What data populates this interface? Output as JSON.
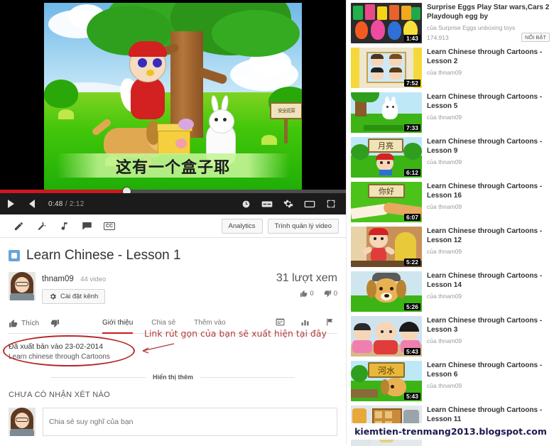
{
  "player": {
    "current_time": "0:48",
    "total_time": "2:12",
    "subtitle": "这有一个盒子耶",
    "sign_text": "安全花草",
    "progress_percent": 37,
    "accent_color": "#cc181e",
    "controls": {
      "play": "play-button",
      "volume": "volume-button",
      "watch_later": "watch-later-icon",
      "captions": "captions-icon",
      "settings": "settings-gear-icon",
      "theater": "theater-mode-icon",
      "fullscreen": "fullscreen-icon"
    }
  },
  "edit_toolbar": {
    "icons": [
      "pencil-icon",
      "magic-wand-icon",
      "music-note-icon",
      "annotation-bubble-icon",
      "cc-icon"
    ],
    "cc_label": "CC",
    "analytics_label": "Analytics",
    "video_manager_label": "Trình quản lý video"
  },
  "video": {
    "title": "Learn Chinese - Lesson 1",
    "channel_name": "thnam09",
    "channel_video_count": "44 video",
    "channel_settings_label": "Cài đặt kênh",
    "views": "31 lượt xem",
    "likes": "0",
    "dislikes": "0"
  },
  "tabs": {
    "like_label": "Thích",
    "items": [
      {
        "label": "Giới thiệu",
        "active": true
      },
      {
        "label": "Chia sẻ",
        "active": false
      },
      {
        "label": "Thêm vào",
        "active": false
      }
    ],
    "icons": [
      "subtitles-icon",
      "statistics-icon",
      "report-flag-icon"
    ]
  },
  "description": {
    "published": "Đã xuất bản vào 23-02-2014",
    "text": "Learn chinese through Cartoons",
    "annotation": "Link rút gọn của bạn sẽ xuất hiện tại đây",
    "annotation_color": "#b23a3a"
  },
  "show_more": {
    "label": "Hiển thị thêm"
  },
  "comments": {
    "empty_label": "CHƯA CÓ NHẬN XÉT NÀO",
    "placeholder": "Chia sẻ suy nghĩ của bạn"
  },
  "sidebar": {
    "watermark": "kiemtien-trenmang2013.blogspot.com",
    "items": [
      {
        "title": "Surprise Eggs Play Star wars,Cars 2 Playdough egg by",
        "by": "của Surprise Eggs unboxing toys",
        "views": "174.913",
        "duration": "1:43",
        "badge": "NỔI BẬT",
        "thumb": "playdough-eggs"
      },
      {
        "title": "Learn Chinese through Cartoons - Lesson 2",
        "by": "của thnam09",
        "views": "",
        "duration": "7:52",
        "badge": "",
        "thumb": "classroom-kids"
      },
      {
        "title": "Learn Chinese through Cartoons - Lesson 5",
        "by": "của thnam09",
        "views": "",
        "duration": "7:33",
        "badge": "",
        "thumb": "rabbit-tree"
      },
      {
        "title": "Learn Chinese through Cartoons - Lesson 9",
        "by": "của thnam09",
        "views": "",
        "duration": "6:12",
        "badge": "",
        "thumb": "moon-sign"
      },
      {
        "title": "Learn Chinese through Cartoons - Lesson 16",
        "by": "của thnam09",
        "views": "",
        "duration": "6:07",
        "badge": "",
        "thumb": "handshake"
      },
      {
        "title": "Learn Chinese through Cartoons - Lesson 12",
        "by": "của thnam09",
        "views": "",
        "duration": "5:22",
        "badge": "",
        "thumb": "kid-indoor"
      },
      {
        "title": "Learn Chinese through Cartoons - Lesson 14",
        "by": "của thnam09",
        "views": "",
        "duration": "5:26",
        "badge": "",
        "thumb": "dog-face"
      },
      {
        "title": "Learn Chinese through Cartoons - Lesson 3",
        "by": "của thnam09",
        "views": "",
        "duration": "5:43",
        "badge": "",
        "thumb": "three-kids"
      },
      {
        "title": "Learn Chinese through Cartoons - Lesson 6",
        "by": "của thnam09",
        "views": "",
        "duration": "5:43",
        "badge": "",
        "thumb": "river-sign"
      },
      {
        "title": "Learn Chinese through Cartoons - Lesson 11",
        "by": "của thnam09",
        "views": "",
        "duration": "",
        "badge": "",
        "thumb": "indoor-scene"
      }
    ],
    "thumb_texts": {
      "moon-sign": "月亮",
      "handshake": "你好",
      "river-sign": "河水"
    }
  }
}
